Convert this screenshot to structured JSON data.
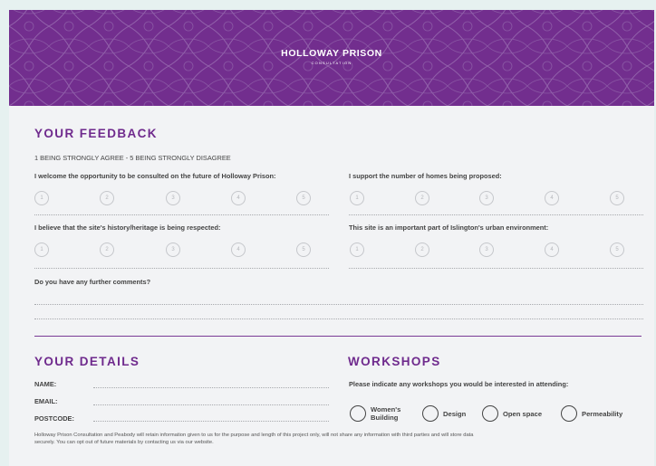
{
  "banner": {
    "title": "HOLLOWAY PRISON",
    "subtitle": "CONSULTATION"
  },
  "feedback": {
    "heading": "YOUR FEEDBACK",
    "scale_note": "1 BEING STRONGLY AGREE - 5 BEING STRONGLY DISAGREE",
    "questions": [
      "I welcome the opportunity to be consulted on the future of Holloway Prison:",
      "I support the number of homes being proposed:",
      "I believe that the site's history/heritage is being respected:",
      "This site is an important part of Islington's urban environment:"
    ],
    "ratings": [
      "1",
      "2",
      "3",
      "4",
      "5"
    ],
    "comments_prompt": "Do you have any further comments?"
  },
  "details": {
    "heading": "YOUR DETAILS",
    "fields": [
      "NAME:",
      "EMAIL:",
      "POSTCODE:"
    ]
  },
  "workshops": {
    "heading": "WORKSHOPS",
    "prompt": "Please indicate any workshops you would be interested in attending:",
    "options": [
      {
        "line1": "Women's",
        "line2": "Building"
      },
      {
        "line1": "Design",
        "line2": ""
      },
      {
        "line1": "Open space",
        "line2": ""
      },
      {
        "line1": "Permeability",
        "line2": ""
      }
    ]
  },
  "footer": {
    "line1": "Holloway Prison Consultation and Peabody will retain information given to us for the purpose and length of this project only, will not share any information with third parties and will store data",
    "line2": "securely. You can opt out of future materials by contacting us via our website."
  },
  "colors": {
    "brand_purple": "#722e8e",
    "heading_purple": "#6f2a8d",
    "page_bg": "#e6f1f0",
    "card_bg": "#f2f3f5"
  }
}
